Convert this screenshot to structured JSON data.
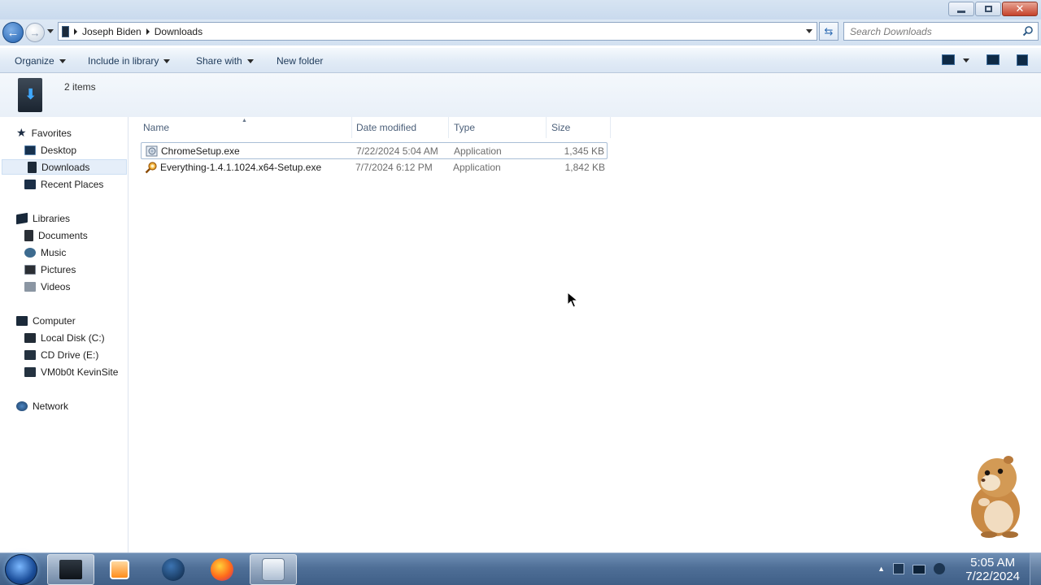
{
  "window": {
    "controls": {
      "minimize": "—",
      "maximize": "❐",
      "close": "✕"
    }
  },
  "address": {
    "crumbs": [
      "Joseph Biden",
      "Downloads"
    ],
    "search_placeholder": "Search Downloads"
  },
  "toolbar": {
    "organize": "Organize",
    "include_in_library": "Include in library",
    "share_with": "Share with",
    "new_folder": "New folder"
  },
  "details": {
    "items_count": "2 items"
  },
  "sidebar": {
    "favorites": {
      "label": "Favorites",
      "items": [
        "Desktop",
        "Downloads",
        "Recent Places"
      ]
    },
    "libraries": {
      "label": "Libraries",
      "items": [
        "Documents",
        "Music",
        "Pictures",
        "Videos"
      ]
    },
    "computer": {
      "label": "Computer",
      "items": [
        "Local Disk (C:)",
        "CD Drive (E:)",
        "VM0b0t KevinSite"
      ]
    },
    "network": {
      "label": "Network"
    },
    "selected": "Downloads"
  },
  "columns": {
    "name": "Name",
    "date": "Date modified",
    "type": "Type",
    "size": "Size"
  },
  "files": [
    {
      "name": "ChromeSetup.exe",
      "date": "7/22/2024 5:04 AM",
      "type": "Application",
      "size": "1,345 KB",
      "icon": "installer-icon"
    },
    {
      "name": "Everything-1.4.1.1024.x64-Setup.exe",
      "date": "7/7/2024 6:12 PM",
      "type": "Application",
      "size": "1,842 KB",
      "icon": "magnifier-app-icon"
    }
  ],
  "taskbar": {
    "time": "5:05 AM",
    "date": "7/22/2024",
    "apps": [
      "explorer-icon",
      "media-player-icon",
      "globe-icon",
      "firefox-icon",
      "installer-icon"
    ]
  }
}
